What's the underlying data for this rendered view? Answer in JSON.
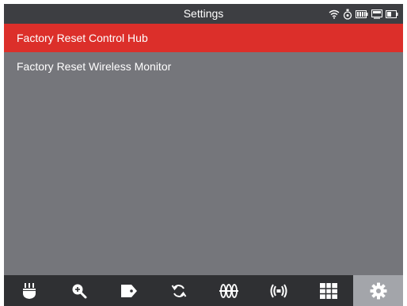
{
  "header": {
    "title": "Settings",
    "status_icons": [
      "wifi-icon",
      "tpms-sensor-icon",
      "battery-icon",
      "monitor-icon",
      "device-battery-icon"
    ]
  },
  "menu": {
    "items": [
      {
        "label": "Factory Reset Control Hub",
        "selected": true
      },
      {
        "label": "Factory Reset Wireless Monitor",
        "selected": false
      }
    ]
  },
  "toolbar": {
    "items": [
      {
        "icon": "connector-icon",
        "active": false
      },
      {
        "icon": "zoom-in-icon",
        "active": false
      },
      {
        "icon": "tag-icon",
        "active": false
      },
      {
        "icon": "refresh-icon",
        "active": false
      },
      {
        "icon": "tire-icon",
        "active": false
      },
      {
        "icon": "wireless-sensor-icon",
        "active": false
      },
      {
        "icon": "grid-icon",
        "active": false
      },
      {
        "icon": "gear-icon",
        "active": true
      }
    ]
  },
  "colors": {
    "header_bg": "#3d3e42",
    "content_bg": "#75767b",
    "selected_bg": "#dc2f2a",
    "toolbar_bg": "#2f3033",
    "toolbar_active_bg": "#a3a5aa"
  }
}
